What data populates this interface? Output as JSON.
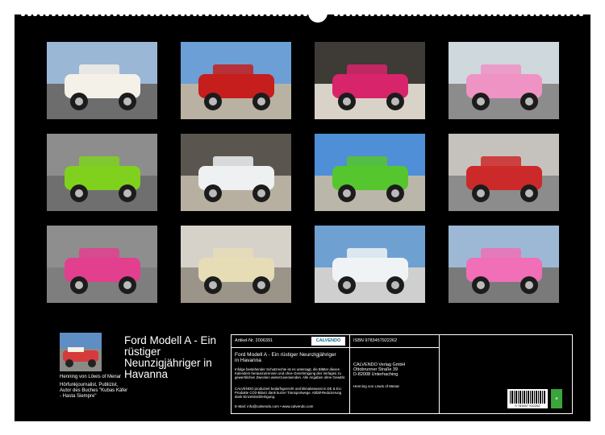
{
  "calendar": {
    "title": "Ford Modell A - Ein rüstiger Neunzigjähriger in Havanna",
    "author_name": "Henning von Löwis of Menar",
    "author_bio": "Hörfunkjournalist, Publizist, Autor des Buches \"Kubas Käfer - Hasta Siempre\""
  },
  "photos": [
    {
      "name": "white-car-front",
      "colors": {
        "sky": "#9bb7d6",
        "ground": "#6d6d6d",
        "car": "#f4f1e8"
      }
    },
    {
      "name": "red-car-street",
      "colors": {
        "sky": "#6b9fd6",
        "ground": "#b9b2a2",
        "car": "#c61d1d"
      }
    },
    {
      "name": "steering-wheel-pink",
      "colors": {
        "sky": "#3e3a35",
        "ground": "#d9d2c8",
        "car": "#d8246a"
      }
    },
    {
      "name": "pink-convertible",
      "colors": {
        "sky": "#cfd8dd",
        "ground": "#8c8c8c",
        "car": "#ef93c4"
      }
    },
    {
      "name": "green-car",
      "colors": {
        "sky": "#8d8d8d",
        "ground": "#6f6f6f",
        "car": "#7fd11e"
      }
    },
    {
      "name": "white-interior",
      "colors": {
        "sky": "#5a564f",
        "ground": "#b7b0a1",
        "car": "#eef0f2"
      }
    },
    {
      "name": "green-car-malecon",
      "colors": {
        "sky": "#4f8fd8",
        "ground": "#bbb6aa",
        "car": "#55c62d"
      }
    },
    {
      "name": "red-car-street-2",
      "colors": {
        "sky": "#c5c2bd",
        "ground": "#8c8c8c",
        "car": "#cc2a2a"
      }
    },
    {
      "name": "pink-wheel-detail",
      "colors": {
        "sky": "#8e8e8e",
        "ground": "#7e7e7e",
        "car": "#e23f8e"
      }
    },
    {
      "name": "cream-roadster",
      "colors": {
        "sky": "#d6d2ca",
        "ground": "#9a9588",
        "car": "#e6ddb7"
      }
    },
    {
      "name": "white-car-interior-2",
      "colors": {
        "sky": "#6fa0d2",
        "ground": "#cfcfcf",
        "car": "#f0f3f6"
      }
    },
    {
      "name": "pink-car-rear",
      "colors": {
        "sky": "#9db8d5",
        "ground": "#7a7a7a",
        "car": "#f06fb6"
      }
    }
  ],
  "info": {
    "article_label": "Artikel-Nr. 2006391",
    "calvendo_logo": "CALVENDO",
    "title_text": "Ford Modell A - Ein rüstiger Neunzigjähriger in Havanna",
    "legal_text_1": "Infolge bestehender Schutzrechte ist es untersagt, die Blätter dieses Kalenders herauszutrennen und ohne Genehmigung des Verlages zu gewerblichen Zwecken weiterzuverwenden. Alle Angaben ohne Gewähr.",
    "legal_text_2": "CALVENDO produziert bedarfsgerecht und klimabewusst in DE & EU. Produkte CO2-Bilanz dank kurzer Transportwege. Abfall-Reduzierung dank Einzelstückfertigung.",
    "email_web": "E-Mail: info@calvendo.com • www.calvendo.com",
    "isbn": "ISBN 9783457922262",
    "publisher_name": "CALVENDO Verlag GmbH",
    "publisher_street": "Ottobrunner Straße 39",
    "publisher_city": "D-82008 Unterhaching",
    "author_credit": "Henning von Löwis of Menar",
    "barcode_number": "9 783457 922262"
  }
}
